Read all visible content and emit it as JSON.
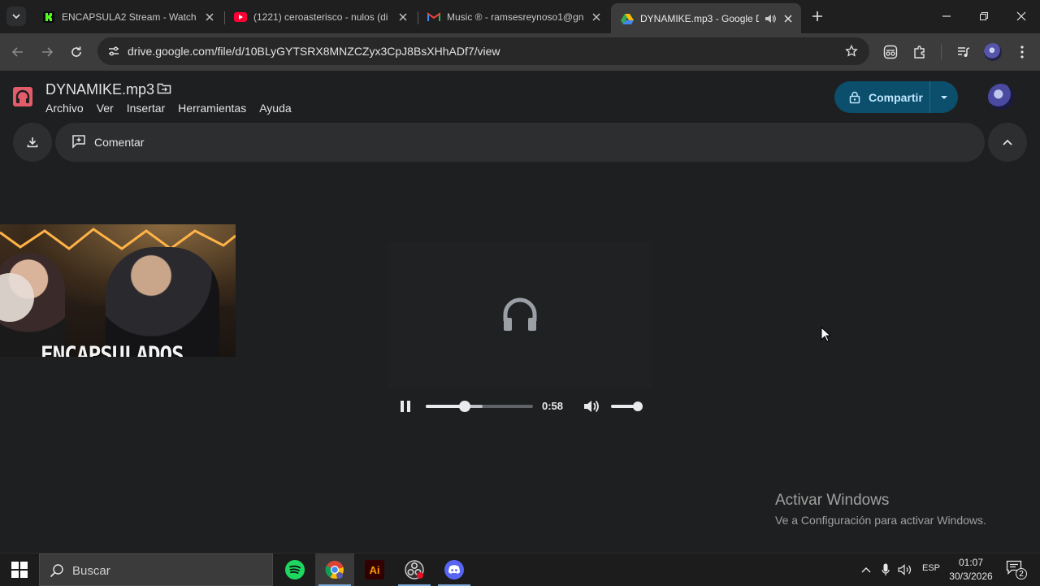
{
  "browser": {
    "tabs": [
      {
        "title": "ENCAPSULA2 Stream - Watch L",
        "favicon": "kick-icon",
        "accent": "#53fc18"
      },
      {
        "title": "(1221) ceroasterisco - nulos (di",
        "favicon": "youtube-icon",
        "accent": "#ff0033"
      },
      {
        "title": "Music ® - ramsesreynoso1@gn",
        "favicon": "gmail-icon",
        "accent": "#ea4335"
      },
      {
        "title": "DYNAMIKE.mp3 - Google D",
        "favicon": "drive-icon",
        "accent": "#fbbc04",
        "active": true,
        "audio": true
      }
    ],
    "url": "drive.google.com/file/d/10BLyGYTSRX8MNZCZyx3CpJ8BsXHhADf7/view"
  },
  "drive": {
    "file_title": "DYNAMIKE.mp3",
    "menu": [
      "Archivo",
      "Ver",
      "Insertar",
      "Herramientas",
      "Ayuda"
    ],
    "share_label": "Compartir",
    "comment_label": "Comentar",
    "accent": "#0b4f6c"
  },
  "webcam": {
    "overlay_text": "ENCAPSULADOS"
  },
  "player": {
    "time": "0:58",
    "state": "playing",
    "progress": 0.36,
    "buffered": 0.53,
    "volume": 1.0
  },
  "watermark": {
    "line1": "Activar Windows",
    "line2": "Ve a Configuración para activar Windows."
  },
  "taskbar": {
    "search_placeholder": "Buscar",
    "apps": [
      "spotify-icon",
      "chrome-icon",
      "illustrator-icon",
      "obs-icon",
      "discord-icon"
    ],
    "illustrator_label": "Ai",
    "language": "ESP",
    "time": "01:07",
    "date": "30/3/2026",
    "notifications": "2"
  }
}
